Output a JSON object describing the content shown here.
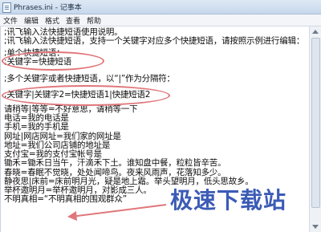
{
  "window": {
    "title": "Phrases.ini - 记事本"
  },
  "menu": [
    {
      "label": "文件"
    },
    {
      "label": "编辑"
    },
    {
      "label": "格式"
    },
    {
      "label": "查看"
    },
    {
      "label": "帮助"
    }
  ],
  "editor": {
    "lines": [
      ";讯飞输入法快捷短语使用说明。",
      ";讯飞输入法快捷短语，支持一个关键字对应多个快捷短语，请按照示例进行编辑：",
      ";单个快捷短语：",
      ";关键字=快捷短语",
      ";多个关键字或者快捷短语，以“|”作为分隔符：",
      ";关键字|关键字2=快捷短语1|快捷短语2",
      "请稍等|等等=不好意思，请稍等一下",
      "电话=我的电话是",
      "手机=我的手机是",
      "网址|网店网址=我们家的网址是",
      "地址=我们公司店铺的地址是",
      "支付宝=我的支付宝帐号是",
      "锄禾=锄禾日当午，汗滴禾下土。谁知盘中餐，粒粒皆辛苦。",
      "春晓=春眠不觉晓，处处闻啼鸟。夜来风雨声，花落知多少。",
      "静夜思|床前=床前明月光，疑是地上霜。举头望明月，低头思故乡。",
      "举杯邀明月=举杯邀明月，对影成三人。",
      "不明真相=“不明真相的围观群众”"
    ]
  },
  "watermark": {
    "text": "极速下载站",
    "color": "#3b5bb5"
  },
  "annotation_color": "#e0767a"
}
